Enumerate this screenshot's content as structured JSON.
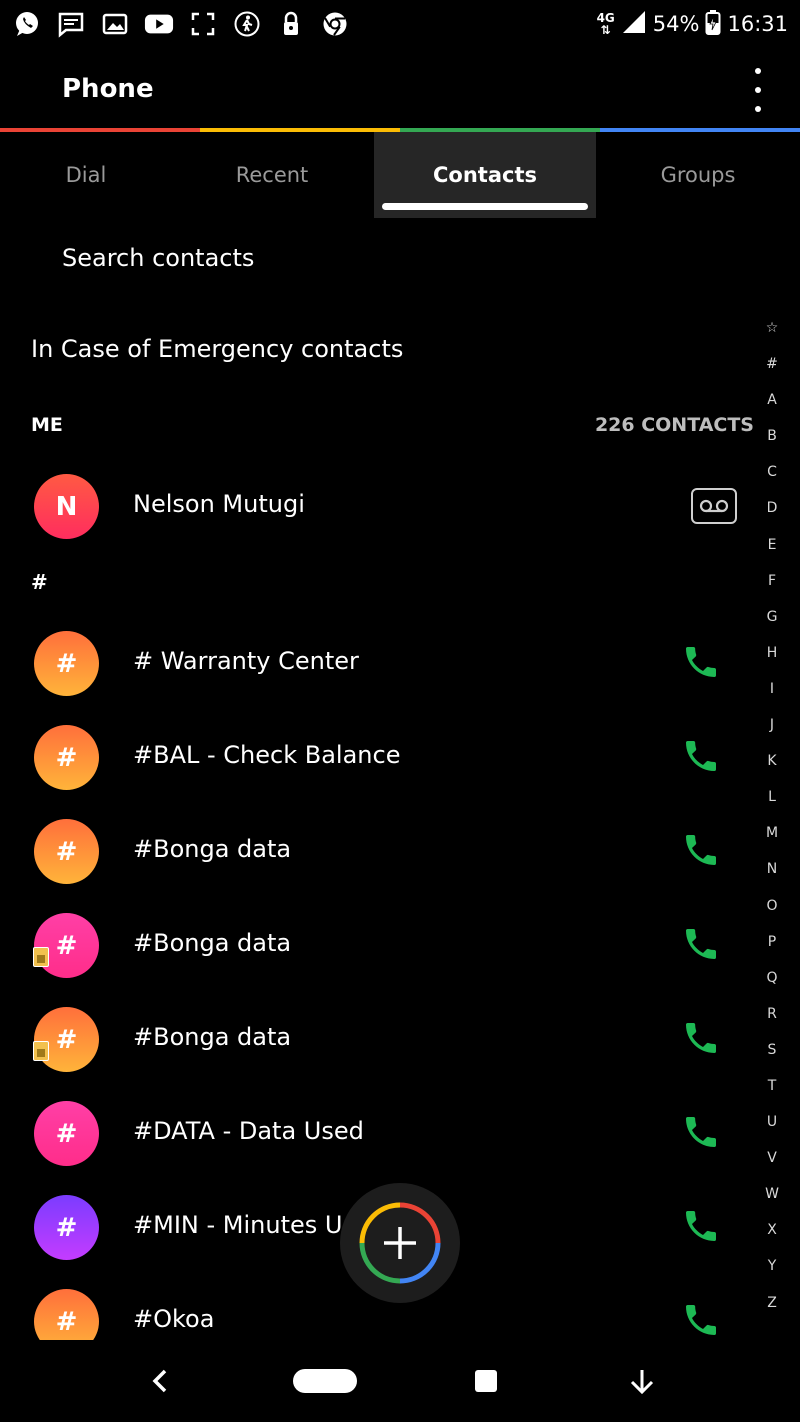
{
  "status_bar": {
    "network": "4G",
    "battery": "54%",
    "time": "16:31"
  },
  "app_bar": {
    "title": "Phone"
  },
  "accent_colors": [
    "#ea4335",
    "#fbbc05",
    "#34a853",
    "#4285f4"
  ],
  "tabs": [
    {
      "label": "Dial"
    },
    {
      "label": "Recent"
    },
    {
      "label": "Contacts",
      "active": true
    },
    {
      "label": "Groups"
    }
  ],
  "search": {
    "placeholder": "Search contacts"
  },
  "ice_label": "In Case of Emergency contacts",
  "me_section": {
    "header": "ME",
    "count": "226 CONTACTS",
    "contact": {
      "initial": "N",
      "name": "Nelson Mutugi",
      "action_icon": "voicemail-icon"
    }
  },
  "hash_section": {
    "header": "#",
    "contacts": [
      {
        "initial": "#",
        "name": "# Warranty Center",
        "color": "orange",
        "sim": false
      },
      {
        "initial": "#",
        "name": "#BAL - Check Balance",
        "color": "orange",
        "sim": false
      },
      {
        "initial": "#",
        "name": "#Bonga data",
        "color": "orange",
        "sim": false
      },
      {
        "initial": "#",
        "name": "#Bonga data",
        "color": "pink",
        "sim": true
      },
      {
        "initial": "#",
        "name": "#Bonga data",
        "color": "orange",
        "sim": true
      },
      {
        "initial": "#",
        "name": "#DATA - Data Used",
        "color": "pink",
        "sim": false
      },
      {
        "initial": "#",
        "name": "#MIN - Minutes Used",
        "color": "purple",
        "sim": false
      },
      {
        "initial": "#",
        "name": "#Okoa",
        "color": "orange",
        "sim": false
      }
    ]
  },
  "index_letters": [
    "☆",
    "#",
    "A",
    "B",
    "C",
    "D",
    "E",
    "F",
    "G",
    "H",
    "I",
    "J",
    "K",
    "L",
    "M",
    "N",
    "O",
    "P",
    "Q",
    "R",
    "S",
    "T",
    "U",
    "V",
    "W",
    "X",
    "Y",
    "Z"
  ],
  "call_color": "#1db954",
  "fab": {
    "icon": "plus-icon"
  },
  "nav_bar": {
    "icons": [
      "back-icon",
      "home-icon",
      "recents-icon",
      "hide-nav-icon"
    ]
  }
}
